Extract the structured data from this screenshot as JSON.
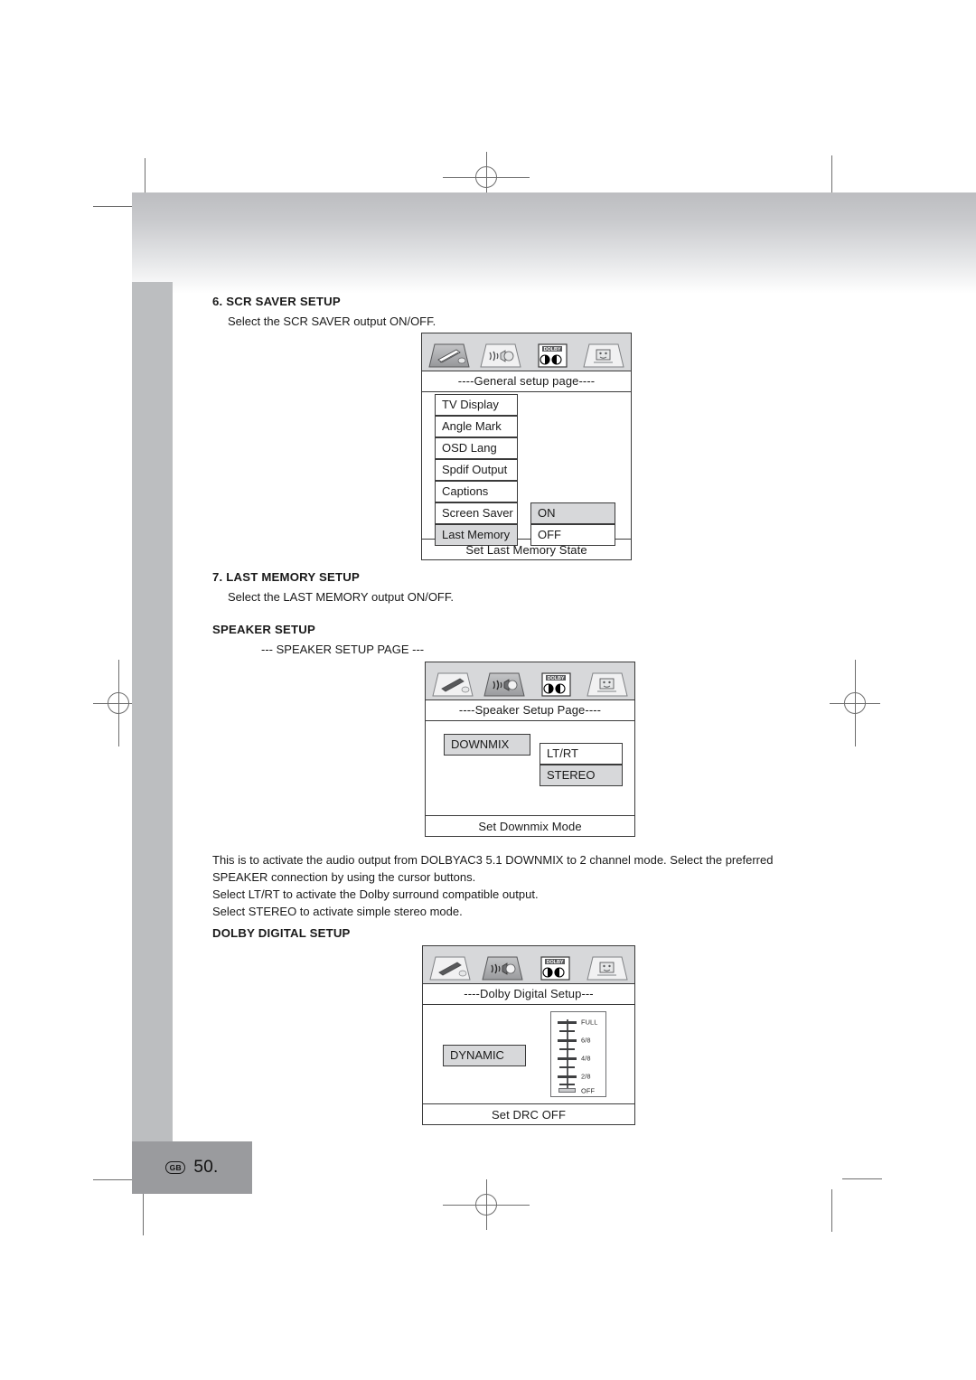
{
  "page": {
    "footer_locale": "GB",
    "footer_page": "50."
  },
  "sections": {
    "scr_saver": {
      "title": "6. SCR SAVER SETUP",
      "body": "Select the SCR SAVER output ON/OFF."
    },
    "last_memory": {
      "title": "7. LAST MEMORY SETUP",
      "body": "Select the LAST MEMORY output ON/OFF."
    },
    "speaker_setup": {
      "title": "SPEAKER SETUP",
      "body": "--- SPEAKER SETUP PAGE ---"
    },
    "dolby_digital_setup": {
      "title": "DOLBY DIGITAL SETUP"
    }
  },
  "paragraph": {
    "line1": "This is to activate the audio output from DOLBYAC3 5.1 DOWNMIX to 2 channel mode. Select the preferred SPEAKER connection by using the cursor buttons.",
    "line2": "Select LT/RT to activate the Dolby surround compatible output.",
    "line3": "Select STEREO to activate simple stereo mode."
  },
  "osd_general": {
    "tabs": [
      {
        "name": "general-setup-tab",
        "selected": true
      },
      {
        "name": "audio-setup-tab",
        "selected": false
      },
      {
        "name": "dolby-setup-tab",
        "selected": false
      },
      {
        "name": "preference-setup-tab",
        "selected": false
      }
    ],
    "header": "----General setup page----",
    "menu": [
      {
        "label": "TV Display",
        "selected": false
      },
      {
        "label": "Angle Mark",
        "selected": false
      },
      {
        "label": "OSD Lang",
        "selected": false
      },
      {
        "label": "Spdif Output",
        "selected": false
      },
      {
        "label": "Captions",
        "selected": false
      },
      {
        "label": "Screen Saver",
        "selected": false
      },
      {
        "label": "Last Memory",
        "selected": true
      }
    ],
    "options": [
      {
        "label": "ON",
        "selected": true
      },
      {
        "label": "OFF",
        "selected": false
      }
    ],
    "footer": "Set Last Memory State"
  },
  "osd_speaker": {
    "tabs": [
      {
        "name": "general-setup-tab",
        "selected": false
      },
      {
        "name": "audio-setup-tab",
        "selected": true
      },
      {
        "name": "dolby-setup-tab",
        "selected": false
      },
      {
        "name": "preference-setup-tab",
        "selected": false
      }
    ],
    "header": "----Speaker Setup Page----",
    "menu": [
      {
        "label": "DOWNMIX",
        "selected": true
      }
    ],
    "options": [
      {
        "label": "LT/RT",
        "selected": false
      },
      {
        "label": "STEREO",
        "selected": true
      }
    ],
    "footer": "Set Downmix Mode"
  },
  "osd_dolby": {
    "tabs": [
      {
        "name": "general-setup-tab",
        "selected": false
      },
      {
        "name": "audio-setup-tab",
        "selected": true
      },
      {
        "name": "dolby-setup-tab",
        "selected": false
      },
      {
        "name": "preference-setup-tab",
        "selected": false
      }
    ],
    "header": "----Dolby Digital Setup---",
    "menu": [
      {
        "label": "DYNAMIC",
        "selected": true
      }
    ],
    "drc": {
      "labels": [
        "FULL",
        "6/8",
        "4/8",
        "2/8",
        "OFF"
      ],
      "value": "OFF"
    },
    "footer": "Set DRC OFF"
  },
  "colors": {
    "selected_fill": "#d7d8da",
    "tab_bar": "#d7d8da",
    "outline": "#3a3a3a",
    "side_strip": "#bcbec0",
    "footer_block": "#9a9b9e"
  }
}
